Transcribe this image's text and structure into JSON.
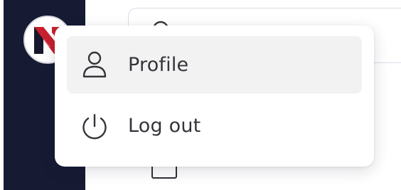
{
  "sidebar": {
    "background_color": "#161b33",
    "avatar": {
      "icon": "brand-logo-icon",
      "colors": [
        "#c8202f",
        "#16172d"
      ]
    }
  },
  "search": {
    "icon": "search-icon",
    "placeholder": ""
  },
  "user_menu": {
    "items": [
      {
        "label": "Profile",
        "icon": "user-icon",
        "active": true
      },
      {
        "label": "Log out",
        "icon": "power-icon",
        "active": false
      }
    ]
  },
  "colors": {
    "menu_text": "#34353a",
    "hover_background": "#f2f2f2"
  }
}
